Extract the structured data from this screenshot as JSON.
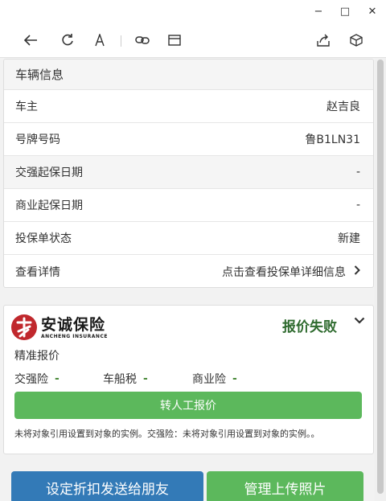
{
  "window": {
    "controls": {
      "minimize": "−",
      "maximize": "□",
      "close": "✕"
    }
  },
  "toolbar": {
    "icons": [
      "back-arrow-icon",
      "refresh-icon",
      "text-size-icon",
      "link-icon",
      "window-icon",
      "share-icon",
      "cube-icon"
    ]
  },
  "vehicle": {
    "header": "车辆信息",
    "rows": [
      {
        "label": "车主",
        "value": "赵吉良"
      },
      {
        "label": "号牌号码",
        "value": "鲁B1LN31"
      },
      {
        "label": "交强起保日期",
        "value": "-"
      },
      {
        "label": "商业起保日期",
        "value": "-"
      },
      {
        "label": "投保单状态",
        "value": "新建"
      },
      {
        "label": "查看详情",
        "value": "点击查看投保单详细信息"
      }
    ]
  },
  "quote": {
    "logo_name": "安诚保险",
    "logo_sub": "ANCHENG INSURANCE",
    "status": "报价失败",
    "precise": "精准报价",
    "fees": [
      {
        "label": "交强险",
        "value": "-"
      },
      {
        "label": "车船税",
        "value": "-"
      },
      {
        "label": "商业险",
        "value": "-"
      }
    ],
    "manual_button": "转人工报价",
    "error": "未将对象引用设置到对象的实例。交强险：未将对象引用设置到对象的实例。。"
  },
  "actions": {
    "discount": "设定折扣发送给朋友",
    "upload": "管理上传照片"
  },
  "colors": {
    "green": "#5cb85c",
    "blue": "#337ab7",
    "status_green": "#2f6b2f",
    "logo_red": "#c0282d"
  }
}
